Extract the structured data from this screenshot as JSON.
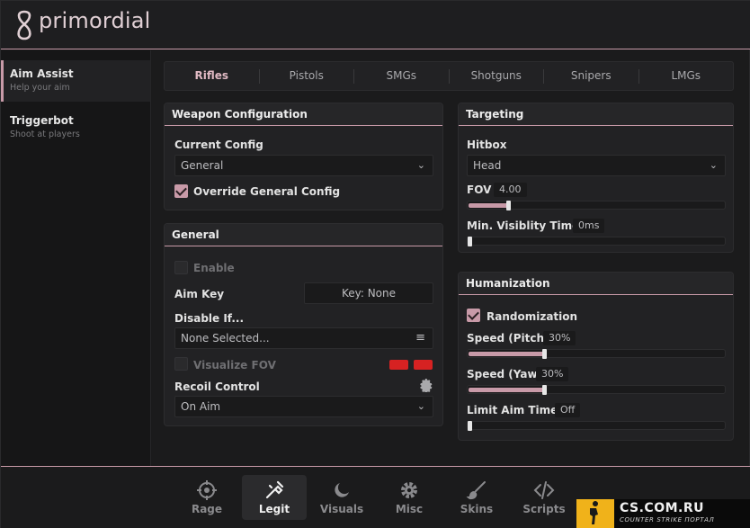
{
  "app": {
    "brand": "primordial"
  },
  "sidebar": {
    "items": [
      {
        "title": "Aim Assist",
        "subtitle": "Help your aim"
      },
      {
        "title": "Triggerbot",
        "subtitle": "Shoot at players"
      }
    ]
  },
  "weapon_tabs": [
    "Rifles",
    "Pistols",
    "SMGs",
    "Shotguns",
    "Snipers",
    "LMGs"
  ],
  "weapon_config": {
    "title": "Weapon Configuration",
    "current_config_label": "Current Config",
    "current_config_value": "General",
    "override_label": "Override General Config",
    "override_checked": true
  },
  "general": {
    "title": "General",
    "enable_label": "Enable",
    "enable_checked": false,
    "aim_key_label": "Aim Key",
    "aim_key_value": "Key: None",
    "disable_if_label": "Disable If...",
    "disable_if_value": "None Selected...",
    "visualize_fov_label": "Visualize FOV",
    "visualize_fov_checked": false,
    "fov_colors": [
      "#d62222",
      "#d62222"
    ],
    "recoil_label": "Recoil Control",
    "recoil_value": "On Aim"
  },
  "targeting": {
    "title": "Targeting",
    "hitbox_label": "Hitbox",
    "hitbox_value": "Head",
    "fov_label": "FOV",
    "fov_value": "4.00",
    "fov_fraction": 0.16,
    "min_vis_label": "Min. Visiblity Time",
    "min_vis_value": "0ms",
    "min_vis_fraction": 0.0
  },
  "humanization": {
    "title": "Humanization",
    "randomization_label": "Randomization",
    "randomization_checked": true,
    "pitch_label": "Speed (Pitch)",
    "pitch_value": "30%",
    "pitch_fraction": 0.3,
    "yaw_label": "Speed (Yaw)",
    "yaw_value": "30%",
    "yaw_fraction": 0.3,
    "limit_label": "Limit Aim Time",
    "limit_value": "Off",
    "limit_fraction": 0.0
  },
  "bottom_nav": [
    {
      "label": "Rage",
      "icon": "crosshair-icon"
    },
    {
      "label": "Legit",
      "icon": "legit-icon"
    },
    {
      "label": "Visuals",
      "icon": "moon-icon"
    },
    {
      "label": "Misc",
      "icon": "gear-icon"
    },
    {
      "label": "Skins",
      "icon": "brush-icon"
    },
    {
      "label": "Scripts",
      "icon": "code-icon"
    }
  ],
  "watermark": {
    "title": "CS.COM.RU",
    "subtitle": "COUNTER STRIKE ПОРТАЛ"
  },
  "colors": {
    "accent": "#c89aa8",
    "background": "#1b1b1c",
    "panel": "#222224"
  }
}
